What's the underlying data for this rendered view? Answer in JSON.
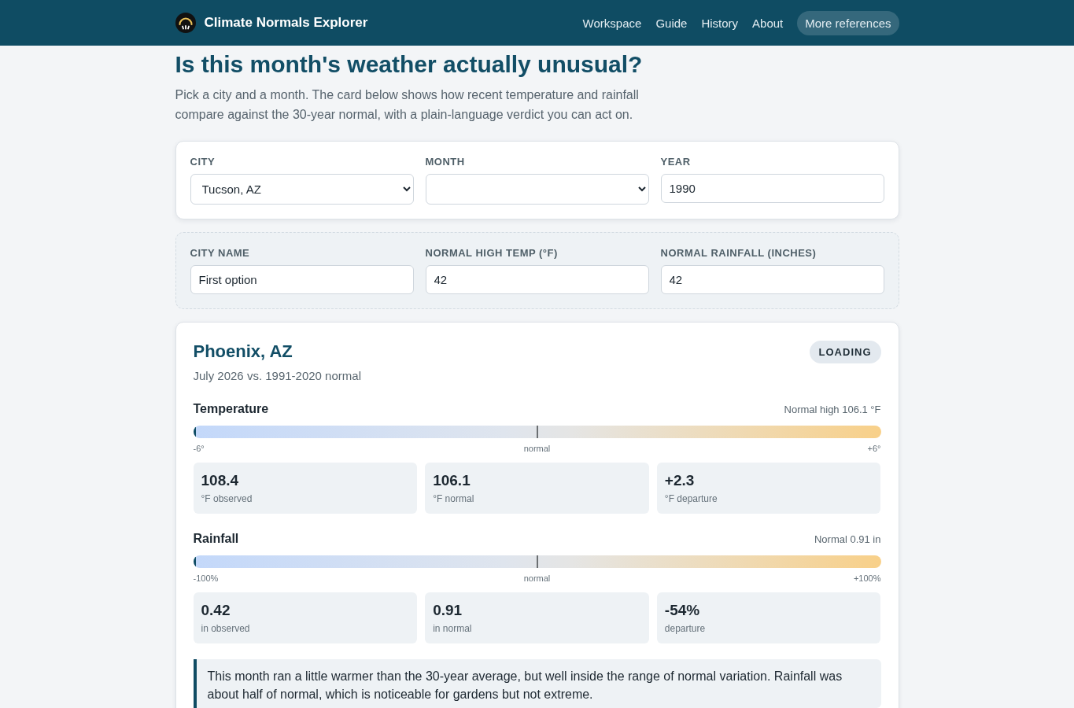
{
  "header": {
    "title": "Climate Normals Explorer",
    "nav": [
      {
        "label": "Workspace",
        "kind": "link"
      },
      {
        "label": "Guide",
        "kind": "link"
      },
      {
        "label": "History",
        "kind": "link"
      },
      {
        "label": "About",
        "kind": "link"
      },
      {
        "label": "More references",
        "kind": "pill"
      }
    ]
  },
  "intro": {
    "heading": "Is this month's weather actually unusual?",
    "text": "Pick a city and a month. The card below shows how recent temperature and rainfall compare against the 30-year normal, with a plain-language verdict you can act on."
  },
  "selectors": {
    "fields": [
      {
        "label": "CITY",
        "kind": "select",
        "value": "Tucson, AZ"
      },
      {
        "label": "MONTH",
        "kind": "select"
      },
      {
        "label": "YEAR",
        "kind": "input",
        "value": "1990"
      }
    ]
  },
  "custom_city": {
    "fields": [
      {
        "label": "CITY NAME",
        "value": "First option"
      },
      {
        "label": "NORMAL HIGH TEMP (°F)",
        "value": "42"
      },
      {
        "label": "NORMAL RAINFALL (INCHES)",
        "value": "42"
      }
    ]
  },
  "result": {
    "city": "Phoenix, AZ",
    "period": "July 2026 vs. 1991-2020 normal",
    "status": "LOADING",
    "metrics": [
      {
        "title": "Temperature",
        "normal_note": "Normal high 106.1 °F",
        "gauge": {
          "level": 0,
          "min_label": "-6°",
          "mid_label": "normal",
          "max_label": "+6°"
        },
        "stats": [
          {
            "value": "108.4",
            "unit": "°F observed"
          },
          {
            "value": "106.1",
            "unit": "°F normal"
          },
          {
            "value": "+2.3",
            "unit": "°F departure"
          }
        ]
      },
      {
        "title": "Rainfall",
        "normal_note": "Normal 0.91 in",
        "gauge": {
          "level": 0,
          "min_label": "-100%",
          "mid_label": "normal",
          "max_label": "+100%"
        },
        "stats": [
          {
            "value": "0.42",
            "unit": "in observed"
          },
          {
            "value": "0.91",
            "unit": "in normal"
          },
          {
            "value": "-54%",
            "unit": "departure"
          }
        ]
      }
    ],
    "verdict": "This month ran a little warmer than the 30-year average, but well inside the range of normal variation. Rainfall was about half of normal, which is noticeable for gardens but not extreme."
  }
}
